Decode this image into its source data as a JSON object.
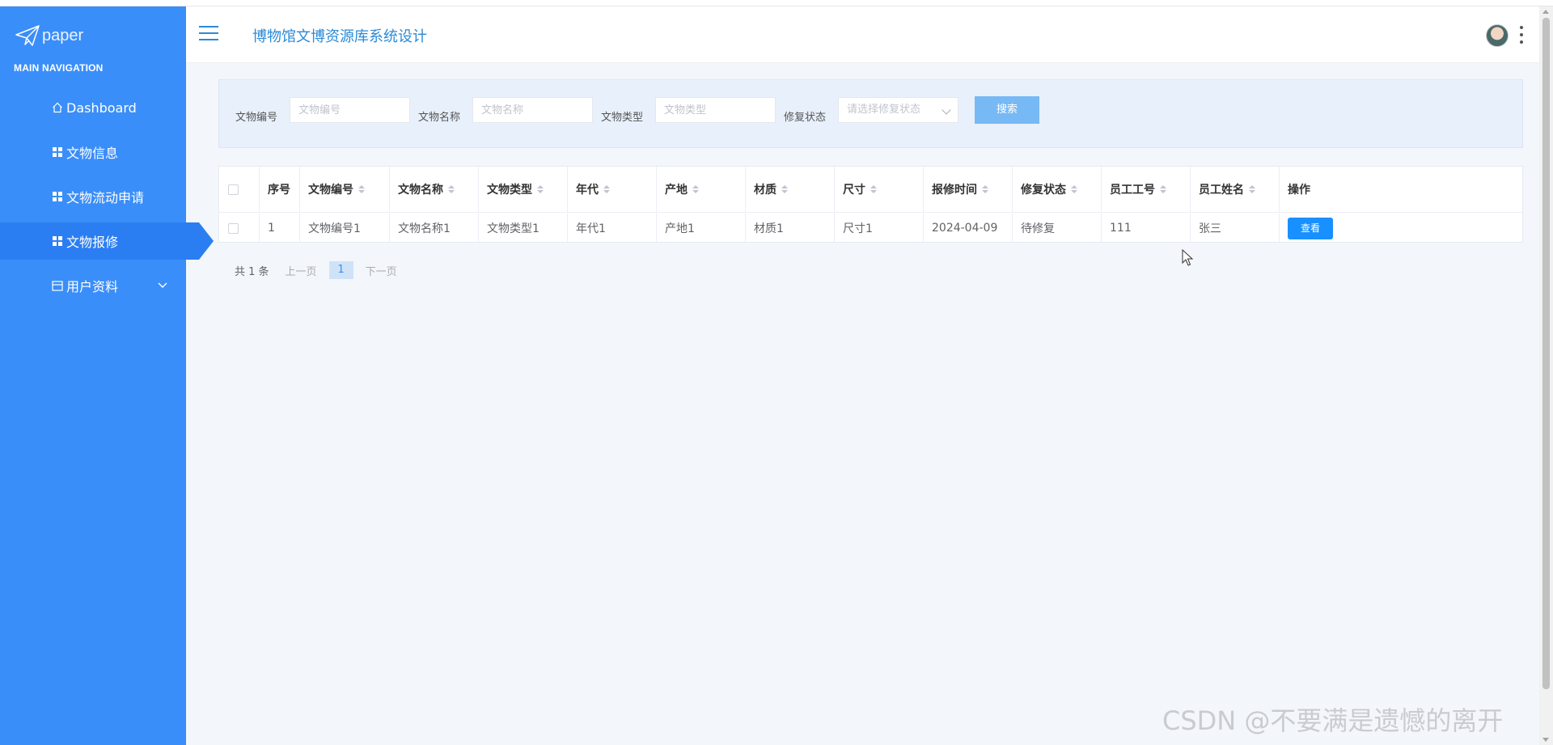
{
  "brand": {
    "text": "paper"
  },
  "sidebar": {
    "heading": "MAIN NAVIGATION",
    "items": [
      {
        "label": "Dashboard",
        "icon": "home-icon"
      },
      {
        "label": "文物信息",
        "icon": "grid-icon"
      },
      {
        "label": "文物流动申请",
        "icon": "grid-icon"
      },
      {
        "label": "文物报修",
        "icon": "grid-icon",
        "active": true
      },
      {
        "label": "用户资料",
        "icon": "card-icon",
        "expandable": true
      }
    ]
  },
  "header": {
    "title": "博物馆文博资源库系统设计"
  },
  "search": {
    "fields": [
      {
        "label": "文物编号",
        "placeholder": "文物编号"
      },
      {
        "label": "文物名称",
        "placeholder": "文物名称"
      },
      {
        "label": "文物类型",
        "placeholder": "文物类型"
      }
    ],
    "select": {
      "label": "修复状态",
      "placeholder": "请选择修复状态"
    },
    "button": "搜索"
  },
  "table": {
    "columns": [
      "序号",
      "文物编号",
      "文物名称",
      "文物类型",
      "年代",
      "产地",
      "材质",
      "尺寸",
      "报修时间",
      "修复状态",
      "员工工号",
      "员工姓名",
      "操作"
    ],
    "rows": [
      [
        "1",
        "文物编号1",
        "文物名称1",
        "文物类型1",
        "年代1",
        "产地1",
        "材质1",
        "尺寸1",
        "2024-04-09",
        "待修复",
        "111",
        "张三"
      ]
    ],
    "action_label": "查看"
  },
  "pagination": {
    "total": "共 1 条",
    "prev": "上一页",
    "page": "1",
    "next": "下一页"
  },
  "watermark": "CSDN @不要满是遗憾的离开",
  "colors": {
    "sidebar": "#3a8ef9",
    "sidebar_active": "#2b7ef2",
    "title": "#2b8ad8",
    "primary_button": "#1890ff",
    "search_button": "#77b9f5"
  }
}
